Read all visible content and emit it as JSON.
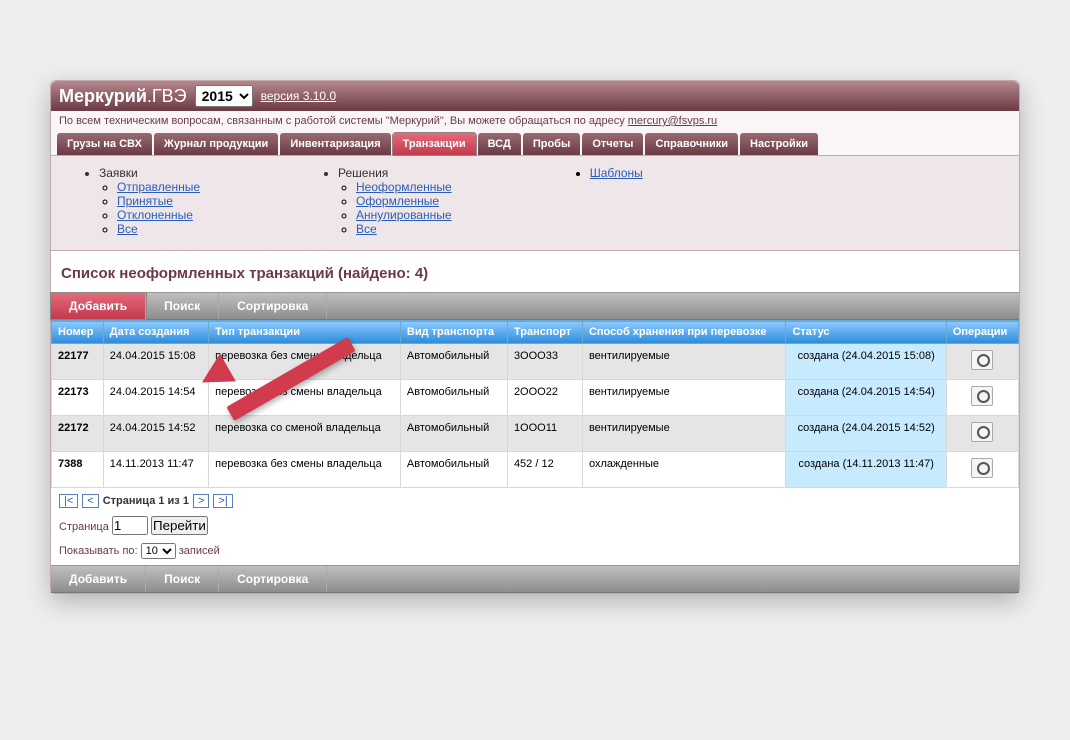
{
  "brand": {
    "main": "Меркурий",
    "sub": ".ГВЭ"
  },
  "year": "2015",
  "version": "версия 3.10.0",
  "support": {
    "text": "По всем техническим вопросам, связанным с работой системы \"Меркурий\", Вы можете обращаться по адресу",
    "email": "mercury@fsvps.ru"
  },
  "tabs": [
    "Грузы на СВХ",
    "Журнал продукции",
    "Инвентаризация",
    "Транзакции",
    "ВСД",
    "Пробы",
    "Отчеты",
    "Справочники",
    "Настройки"
  ],
  "active_tab": 3,
  "submenu": {
    "col1": {
      "title": "Заявки",
      "items": [
        "Отправленные",
        "Принятые",
        "Отклоненные",
        "Все"
      ]
    },
    "col2": {
      "title": "Решения",
      "items": [
        "Неоформленные",
        "Оформленные",
        "Аннулированные",
        "Все"
      ]
    },
    "col3": {
      "items": [
        "Шаблоны"
      ]
    }
  },
  "page_title": "Список неоформленных транзакций (найдено: 4)",
  "toolbar": [
    "Добавить",
    "Поиск",
    "Сортировка"
  ],
  "active_toolbar": 0,
  "columns": [
    "Номер",
    "Дата создания",
    "Тип транзакции",
    "Вид транспорта",
    "Транспорт",
    "Способ хранения при перевозке",
    "Статус",
    "Операции"
  ],
  "rows": [
    {
      "num": "22177",
      "date": "24.04.2015 15:08",
      "type": "перевозка без смены владельца",
      "transport_kind": "Автомобильный",
      "transport": "3ООО33",
      "storage": "вентилируемые",
      "status": "создана (24.04.2015 15:08)"
    },
    {
      "num": "22173",
      "date": "24.04.2015 14:54",
      "type": "перевозка без смены владельца",
      "transport_kind": "Автомобильный",
      "transport": "2ООО22",
      "storage": "вентилируемые",
      "status": "создана (24.04.2015 14:54)"
    },
    {
      "num": "22172",
      "date": "24.04.2015 14:52",
      "type": "перевозка со сменой владельца",
      "transport_kind": "Автомобильный",
      "transport": "1ООО11",
      "storage": "вентилируемые",
      "status": "создана (24.04.2015 14:52)"
    },
    {
      "num": "7388",
      "date": "14.11.2013 11:47",
      "type": "перевозка без смены владельца",
      "transport_kind": "Автомобильный",
      "transport": "452 / 12",
      "storage": "охлажденные",
      "status": "создана (14.11.2013 11:47)"
    }
  ],
  "pager": {
    "first": "|<",
    "prev": "<",
    "next": ">",
    "last": ">|",
    "pos": "Страница 1 из 1",
    "goto_label": "Страница",
    "goto_value": "1",
    "goto_btn": "Перейти",
    "show_label": "Показывать по:",
    "show_value": "10",
    "show_suffix": "записей"
  }
}
